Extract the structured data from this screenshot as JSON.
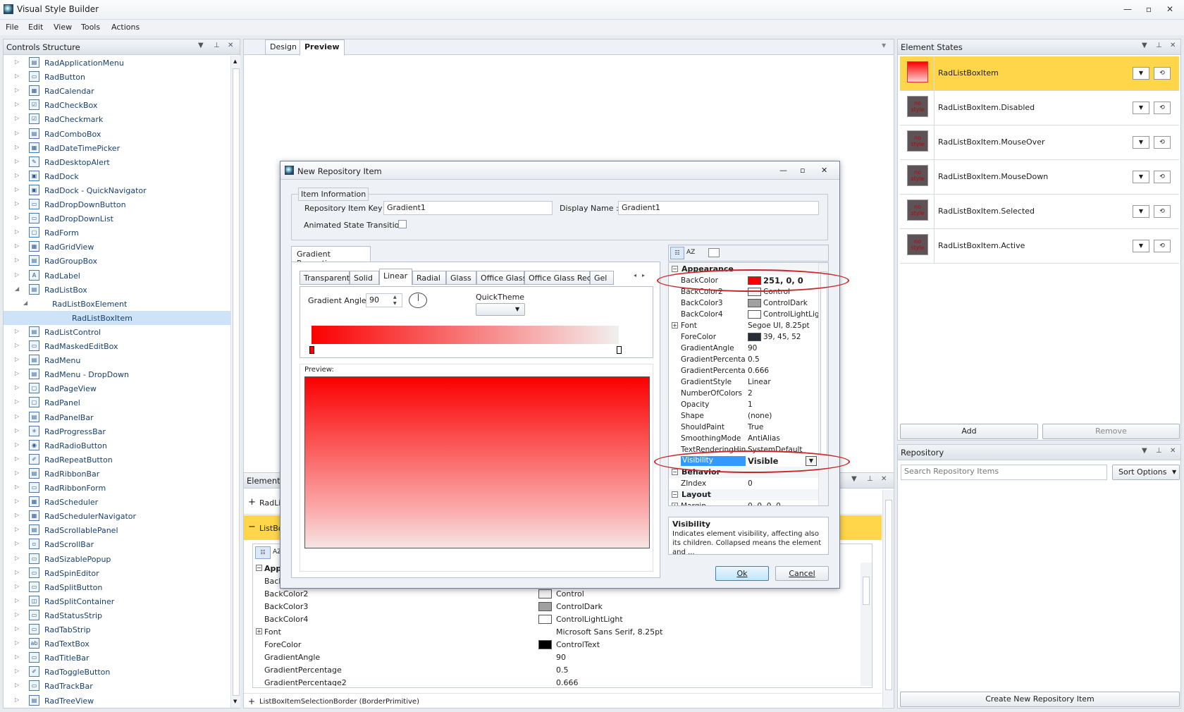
{
  "app": {
    "title": "Visual Style Builder"
  },
  "menu": [
    "File",
    "Edit",
    "View",
    "Tools",
    "Actions"
  ],
  "controls": {
    "title": "Controls Structure",
    "items": [
      {
        "label": "RadApplicationMenu",
        "level": 0,
        "arrow": "▷"
      },
      {
        "label": "RadButton",
        "level": 0,
        "arrow": "▷"
      },
      {
        "label": "RadCalendar",
        "level": 0,
        "arrow": "▷"
      },
      {
        "label": "RadCheckBox",
        "level": 0,
        "arrow": "▷"
      },
      {
        "label": "RadCheckmark",
        "level": 0,
        "arrow": "▷"
      },
      {
        "label": "RadComboBox",
        "level": 0,
        "arrow": "▷"
      },
      {
        "label": "RadDateTimePicker",
        "level": 0,
        "arrow": "▷"
      },
      {
        "label": "RadDesktopAlert",
        "level": 0,
        "arrow": "▷"
      },
      {
        "label": "RadDock",
        "level": 0,
        "arrow": "▷"
      },
      {
        "label": "RadDock - QuickNavigator",
        "level": 0,
        "arrow": "▷"
      },
      {
        "label": "RadDropDownButton",
        "level": 0,
        "arrow": "▷"
      },
      {
        "label": "RadDropDownList",
        "level": 0,
        "arrow": "▷"
      },
      {
        "label": "RadForm",
        "level": 0,
        "arrow": "▷"
      },
      {
        "label": "RadGridView",
        "level": 0,
        "arrow": "▷"
      },
      {
        "label": "RadGroupBox",
        "level": 0,
        "arrow": "▷"
      },
      {
        "label": "RadLabel",
        "level": 0,
        "arrow": "▷"
      },
      {
        "label": "RadListBox",
        "level": 0,
        "arrow": "◢"
      },
      {
        "label": "RadListBoxElement",
        "level": 1,
        "arrow": "◢"
      },
      {
        "label": "RadListBoxItem",
        "level": 2,
        "arrow": ""
      },
      {
        "label": "RadListControl",
        "level": 0,
        "arrow": "▷"
      },
      {
        "label": "RadMaskedEditBox",
        "level": 0,
        "arrow": "▷"
      },
      {
        "label": "RadMenu",
        "level": 0,
        "arrow": "▷"
      },
      {
        "label": "RadMenu - DropDown",
        "level": 0,
        "arrow": "▷"
      },
      {
        "label": "RadPageView",
        "level": 0,
        "arrow": "▷"
      },
      {
        "label": "RadPanel",
        "level": 0,
        "arrow": "▷"
      },
      {
        "label": "RadPanelBar",
        "level": 0,
        "arrow": "▷"
      },
      {
        "label": "RadProgressBar",
        "level": 0,
        "arrow": "▷"
      },
      {
        "label": "RadRadioButton",
        "level": 0,
        "arrow": "▷"
      },
      {
        "label": "RadRepeatButton",
        "level": 0,
        "arrow": "▷"
      },
      {
        "label": "RadRibbonBar",
        "level": 0,
        "arrow": "▷"
      },
      {
        "label": "RadRibbonForm",
        "level": 0,
        "arrow": "▷"
      },
      {
        "label": "RadScheduler",
        "level": 0,
        "arrow": "▷"
      },
      {
        "label": "RadSchedulerNavigator",
        "level": 0,
        "arrow": "▷"
      },
      {
        "label": "RadScrollablePanel",
        "level": 0,
        "arrow": "▷"
      },
      {
        "label": "RadScrollBar",
        "level": 0,
        "arrow": "▷"
      },
      {
        "label": "RadSizablePopup",
        "level": 0,
        "arrow": "▷"
      },
      {
        "label": "RadSpinEditor",
        "level": 0,
        "arrow": "▷"
      },
      {
        "label": "RadSplitButton",
        "level": 0,
        "arrow": "▷"
      },
      {
        "label": "RadSplitContainer",
        "level": 0,
        "arrow": "▷"
      },
      {
        "label": "RadStatusStrip",
        "level": 0,
        "arrow": "▷"
      },
      {
        "label": "RadTabStrip",
        "level": 0,
        "arrow": "▷"
      },
      {
        "label": "RadTextBox",
        "level": 0,
        "arrow": "▷"
      },
      {
        "label": "RadTitleBar",
        "level": 0,
        "arrow": "▷"
      },
      {
        "label": "RadToggleButton",
        "level": 0,
        "arrow": "▷"
      },
      {
        "label": "RadTrackBar",
        "level": 0,
        "arrow": "▷"
      },
      {
        "label": "RadTreeView",
        "level": 0,
        "arrow": "▷"
      }
    ]
  },
  "center": {
    "tabs": [
      "Design",
      "Preview"
    ],
    "elements": {
      "title": "Elements",
      "row1": "RadLi",
      "row2": "ListBo",
      "props": [
        {
          "name": "App",
          "value": "",
          "swatch": null,
          "cat": true
        },
        {
          "name": "Back",
          "value": "",
          "swatch": null
        },
        {
          "name": "BackColor2",
          "value": "Control",
          "swatch": "#f0f0f0"
        },
        {
          "name": "BackColor3",
          "value": "ControlDark",
          "swatch": "#a0a0a0"
        },
        {
          "name": "BackColor4",
          "value": "ControlLightLight",
          "swatch": "#ffffff"
        },
        {
          "name": "Font",
          "value": "Microsoft Sans Serif, 8.25pt",
          "swatch": null,
          "plus": true
        },
        {
          "name": "ForeColor",
          "value": "ControlText",
          "swatch": "#000000"
        },
        {
          "name": "GradientAngle",
          "value": "90",
          "swatch": null
        },
        {
          "name": "GradientPercentage",
          "value": "0.5",
          "swatch": null
        },
        {
          "name": "GradientPercentage2",
          "value": "0.666",
          "swatch": null
        }
      ],
      "bottom": "ListBoxItemSelectionBorder (BorderPrimitive)"
    }
  },
  "states": {
    "title": "Element States",
    "items": [
      {
        "name": "RadListBoxItem",
        "selected": true
      },
      {
        "name": "RadListBoxItem.Disabled"
      },
      {
        "name": "RadListBoxItem.MouseOver"
      },
      {
        "name": "RadListBoxItem.MouseDown"
      },
      {
        "name": "RadListBoxItem.Selected"
      },
      {
        "name": "RadListBoxItem.Active"
      }
    ],
    "no_style": "no style",
    "add": "Add",
    "remove": "Remove"
  },
  "repository": {
    "title": "Repository",
    "search_placeholder": "Search Repository Items",
    "sort": "Sort Options",
    "create": "Create New Repository Item"
  },
  "dialog": {
    "title": "New Repository Item",
    "info_group": "Item Information",
    "key_label": "Repository Item Key :",
    "key_value": "Gradient1",
    "display_label": "Display Name :",
    "display_value": "Gradient1",
    "animated_label": "Animated State Transition",
    "grad_tab": "Gradient Properties",
    "grad_tabs": [
      "Transparent",
      "Solid",
      "Linear",
      "Radial",
      "Glass",
      "Office Glass",
      "Office Glass Rect",
      "Gel"
    ],
    "angle_label": "Gradient Angle:",
    "angle_value": "90",
    "quicktheme": "QuickTheme",
    "preview_label": "Preview:",
    "props": [
      {
        "type": "cat",
        "name": "Appearance"
      },
      {
        "type": "row",
        "name": "BackColor",
        "value": "251, 0, 0",
        "swatch": "#fb0000",
        "bold": true
      },
      {
        "type": "row",
        "name": "BackColor2",
        "value": "Control",
        "swatch": "#f0f0f0"
      },
      {
        "type": "row",
        "name": "BackColor3",
        "value": "ControlDark",
        "swatch": "#a0a0a0"
      },
      {
        "type": "row",
        "name": "BackColor4",
        "value": "ControlLightLigh",
        "swatch": "#ffffff"
      },
      {
        "type": "row",
        "name": "Font",
        "value": "Segoe UI, 8.25pt",
        "plus": true
      },
      {
        "type": "row",
        "name": "ForeColor",
        "value": "39, 45, 52",
        "swatch": "#272d34"
      },
      {
        "type": "row",
        "name": "GradientAngle",
        "value": "90"
      },
      {
        "type": "row",
        "name": "GradientPercentag",
        "value": "0.5"
      },
      {
        "type": "row",
        "name": "GradientPercentag",
        "value": "0.666"
      },
      {
        "type": "row",
        "name": "GradientStyle",
        "value": "Linear"
      },
      {
        "type": "row",
        "name": "NumberOfColors",
        "value": "2"
      },
      {
        "type": "row",
        "name": "Opacity",
        "value": "1"
      },
      {
        "type": "row",
        "name": "Shape",
        "value": "(none)"
      },
      {
        "type": "row",
        "name": "ShouldPaint",
        "value": "True"
      },
      {
        "type": "row",
        "name": "SmoothingMode",
        "value": "AntiAlias"
      },
      {
        "type": "row",
        "name": "TextRenderingHin",
        "value": "SystemDefault"
      },
      {
        "type": "row",
        "name": "Visibility",
        "value": "Visible",
        "selected": true,
        "bold": true
      },
      {
        "type": "cat",
        "name": "Behavior"
      },
      {
        "type": "row",
        "name": "ZIndex",
        "value": "0"
      },
      {
        "type": "cat",
        "name": "Layout"
      },
      {
        "type": "row",
        "name": "Margin",
        "value": "0, 0, 0, 0",
        "plus": true
      }
    ],
    "help_title": "Visibility",
    "help_text": "Indicates element visibility, affecting also its children. Collapsed means the element and ...",
    "ok": "Ok",
    "cancel": "Cancel"
  },
  "colors": {
    "accent": "#fb0000",
    "selection": "#cde3f8",
    "state_selected": "#ffd54a"
  }
}
